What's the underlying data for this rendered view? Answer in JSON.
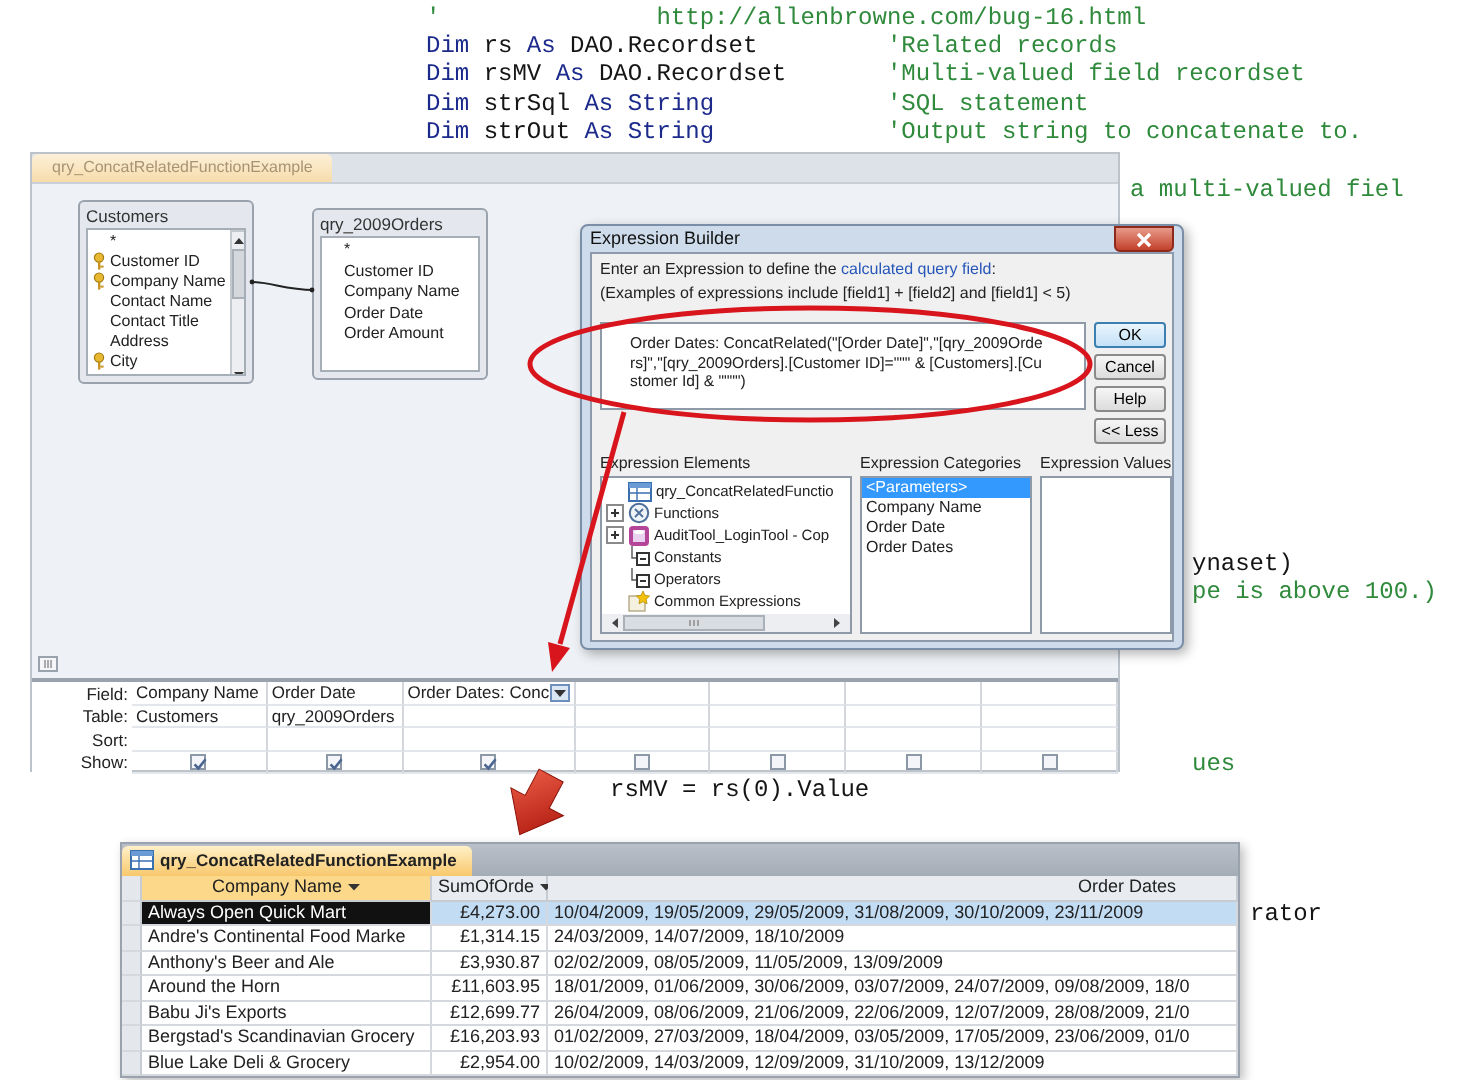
{
  "code_editor": {
    "lines": [
      {
        "kind": "url",
        "tokens": [
          {
            "kind": "comment",
            "text": "'"
          }
        ],
        "comment": "http://allenbrowne.com/bug-16.html"
      },
      {
        "kind": "declaration",
        "tokens": [
          {
            "kind": "keyword",
            "text": "Dim"
          },
          {
            "kind": "plain",
            "text": "rs"
          },
          {
            "kind": "keyword",
            "text": "As"
          },
          {
            "kind": "plain",
            "text": "DAO.Recordset"
          }
        ],
        "comment": "'Related records"
      },
      {
        "kind": "declaration",
        "tokens": [
          {
            "kind": "keyword",
            "text": "Dim"
          },
          {
            "kind": "plain",
            "text": "rsMV"
          },
          {
            "kind": "keyword",
            "text": "As"
          },
          {
            "kind": "plain",
            "text": "DAO.Recordset"
          }
        ],
        "comment": "'Multi-valued field recordset"
      },
      {
        "kind": "declaration",
        "tokens": [
          {
            "kind": "keyword",
            "text": "Dim"
          },
          {
            "kind": "plain",
            "text": "strSql"
          },
          {
            "kind": "keyword",
            "text": "As"
          },
          {
            "kind": "keyword",
            "text": "String"
          }
        ],
        "comment": "'SQL statement"
      },
      {
        "kind": "declaration",
        "tokens": [
          {
            "kind": "keyword",
            "text": "Dim"
          },
          {
            "kind": "plain",
            "text": "strOut"
          },
          {
            "kind": "keyword",
            "text": "As"
          },
          {
            "kind": "keyword",
            "text": "String"
          }
        ],
        "comment": "'Output string to concatenate to."
      }
    ],
    "fragments": [
      {
        "kind": "comment",
        "text": "a multi-valued fiel"
      },
      {
        "kind": "plain",
        "text": "ynaset)"
      },
      {
        "kind": "comment",
        "text": "pe is above 100.)"
      },
      {
        "kind": "comment",
        "text": "ues"
      },
      {
        "kind": "plain",
        "text": "rsMV = rs(0).Value"
      },
      {
        "kind": "plain",
        "text": "rator"
      }
    ]
  },
  "query_design": {
    "tab": "qry_ConcatRelatedFunctionExample",
    "tables": [
      {
        "title": "Customers",
        "fields": [
          {
            "name": "*",
            "key": false
          },
          {
            "name": "Customer ID",
            "key": true
          },
          {
            "name": "Company Name",
            "key": true
          },
          {
            "name": "Contact Name",
            "key": false
          },
          {
            "name": "Contact Title",
            "key": false
          },
          {
            "name": "Address",
            "key": false
          },
          {
            "name": "City",
            "key": true
          }
        ]
      },
      {
        "title": "qry_2009Orders",
        "fields": [
          {
            "name": "*",
            "key": false
          },
          {
            "name": "Customer ID",
            "key": false
          },
          {
            "name": "Company Name",
            "key": false
          },
          {
            "name": "Order Date",
            "key": false
          },
          {
            "name": "Order Amount",
            "key": false
          }
        ]
      }
    ],
    "grid": {
      "row_labels": [
        "Field:",
        "Table:",
        "Sort:",
        "Show:"
      ],
      "columns": [
        {
          "field": "Company Name",
          "table": "Customers",
          "show": true,
          "dropdown": false
        },
        {
          "field": "Order Date",
          "table": "qry_2009Orders",
          "show": true,
          "dropdown": false
        },
        {
          "field": "Order Dates: Conc",
          "show": true,
          "dropdown": true
        },
        {
          "show": false
        },
        {
          "show": false
        },
        {
          "show": false
        },
        {
          "show": false
        }
      ]
    }
  },
  "expression_builder": {
    "title": "Expression Builder",
    "prompt": {
      "before": "Enter an Expression to define the",
      "link": "calculated query field",
      "after": ":"
    },
    "examples": "(Examples of expressions include [field1] + [field2] and [field1] < 5)",
    "expression": "Order Dates: ConcatRelated(\"[Order Date]\",\"[qry_2009Orders]\",\"[qry_2009Orders].[Customer ID]=\"\"\" & [Customers].[Customer Id] & \"\"\"\")",
    "buttons": [
      {
        "label": "OK",
        "default": true
      },
      {
        "label": "Cancel",
        "default": false
      },
      {
        "label": "Help",
        "default": false
      },
      {
        "label": "<< Less",
        "default": false
      }
    ],
    "panels": [
      {
        "kind": "tree",
        "label": "Expression Elements",
        "items": [
          {
            "text": "qry_ConcatRelatedFunctio",
            "expandable": false
          },
          {
            "text": "Functions",
            "expandable": true
          },
          {
            "text": "AuditTool_LoginTool - Cop",
            "expandable": true
          },
          {
            "text": "Constants",
            "expandable": false
          },
          {
            "text": "Operators",
            "expandable": false
          },
          {
            "text": "Common Expressions",
            "expandable": false
          }
        ]
      },
      {
        "kind": "list",
        "label": "Expression Categories",
        "items": [
          {
            "text": "<Parameters>",
            "selected": true
          },
          {
            "text": "Company Name",
            "selected": false
          },
          {
            "text": "Order Date",
            "selected": false
          },
          {
            "text": "Order Dates",
            "selected": false
          }
        ]
      },
      {
        "kind": "list",
        "label": "Expression Values"
      }
    ]
  },
  "datasheet": {
    "tab": "qry_ConcatRelatedFunctionExample",
    "columns": [
      {
        "label": "Company Name",
        "filter": true,
        "selected": true
      },
      {
        "label": "SumOfOrde",
        "filter": true,
        "selected": false
      },
      {
        "label": "Order Dates",
        "filter": false,
        "selected": false
      }
    ],
    "rows": [
      {
        "selected": true,
        "cells": [
          "Always Open Quick Mart",
          "£4,273.00",
          "10/04/2009, 19/05/2009, 29/05/2009, 31/08/2009, 30/10/2009, 23/11/2009"
        ]
      },
      {
        "selected": false,
        "cells": [
          "Andre's Continental Food Marke",
          "£1,314.15",
          "24/03/2009, 14/07/2009, 18/10/2009"
        ]
      },
      {
        "selected": false,
        "cells": [
          "Anthony's Beer and Ale",
          "£3,930.87",
          "02/02/2009, 08/05/2009, 11/05/2009, 13/09/2009"
        ]
      },
      {
        "selected": false,
        "cells": [
          "Around the Horn",
          "£11,603.95",
          "18/01/2009, 01/06/2009, 30/06/2009, 03/07/2009, 24/07/2009, 09/08/2009, 18/0"
        ]
      },
      {
        "selected": false,
        "cells": [
          "Babu Ji's Exports",
          "£12,699.77",
          "26/04/2009, 08/06/2009, 21/06/2009, 22/06/2009, 12/07/2009, 28/08/2009, 21/0"
        ]
      },
      {
        "selected": false,
        "cells": [
          "Bergstad's Scandinavian Grocery",
          "£16,203.93",
          "01/02/2009, 27/03/2009, 18/04/2009, 03/05/2009, 17/05/2009, 23/06/2009, 01/0"
        ]
      },
      {
        "selected": false,
        "cells": [
          "Blue Lake Deli & Grocery",
          "£2,954.00",
          "10/02/2009, 14/03/2009, 12/09/2009, 31/10/2009, 13/12/2009"
        ]
      }
    ]
  }
}
